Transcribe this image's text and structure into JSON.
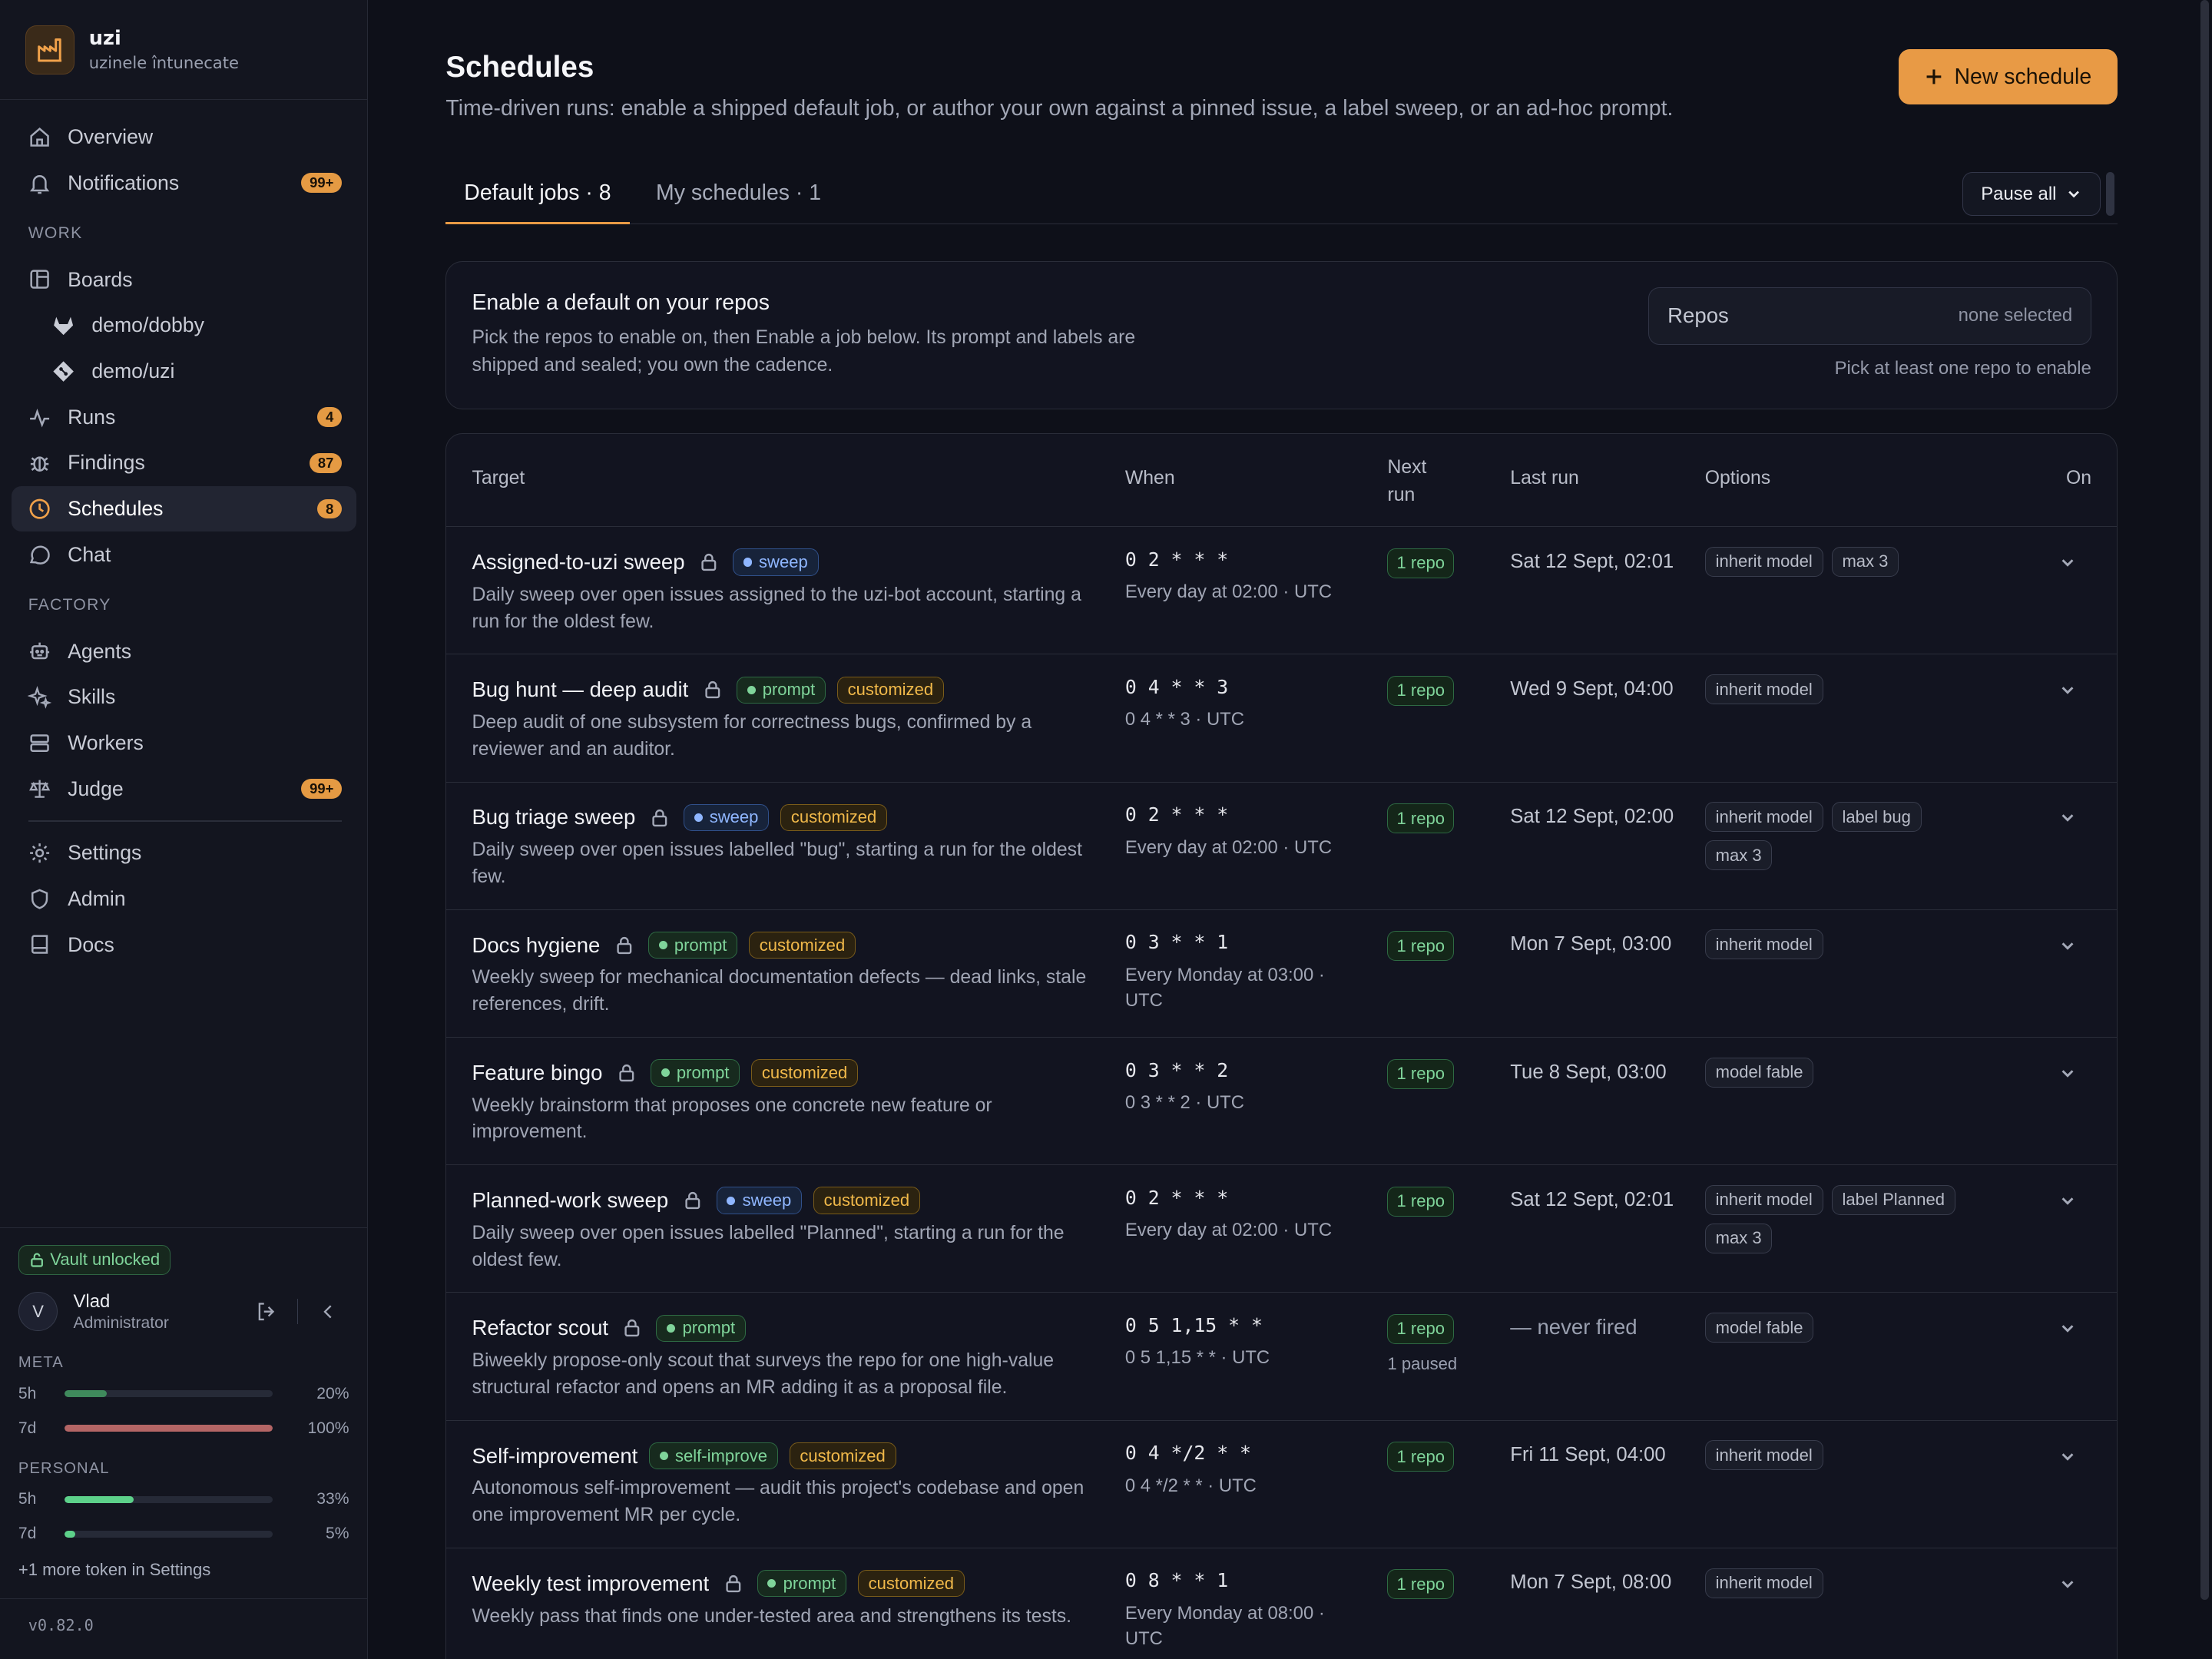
{
  "brand": {
    "name": "uzi",
    "subtitle": "uzinele întunecate"
  },
  "nav": {
    "overview": "Overview",
    "notifications": "Notifications",
    "notifications_badge": "99+",
    "work_section": "WORK",
    "boards": "Boards",
    "repo1": "demo/dobby",
    "repo2": "demo/uzi",
    "runs": "Runs",
    "runs_badge": "4",
    "findings": "Findings",
    "findings_badge": "87",
    "schedules": "Schedules",
    "schedules_badge": "8",
    "chat": "Chat",
    "factory_section": "FACTORY",
    "agents": "Agents",
    "skills": "Skills",
    "workers": "Workers",
    "judge": "Judge",
    "judge_badge": "99+",
    "settings": "Settings",
    "admin": "Admin",
    "docs": "Docs"
  },
  "sidebar_footer": {
    "vault": "Vault unlocked",
    "avatar_initial": "V",
    "user_name": "Vlad",
    "user_role": "Administrator",
    "meta_label": "META",
    "meta_5h_label": "5h",
    "meta_5h_value": "20%",
    "meta_5h_fraction": 0.2,
    "meta_7d_label": "7d",
    "meta_7d_value": "100%",
    "meta_7d_fraction": 1.0,
    "personal_label": "PERSONAL",
    "personal_5h_label": "5h",
    "personal_5h_value": "33%",
    "personal_5h_fraction": 0.33,
    "personal_7d_label": "7d",
    "personal_7d_value": "5%",
    "personal_7d_fraction": 0.05,
    "more_tokens": "+1 more token in Settings",
    "version": "v0.82.0"
  },
  "colors": {
    "accent": "#e89a45",
    "meta_5h": "#3f8a5c",
    "meta_7d": "#b46565",
    "personal": "#5dd18a"
  },
  "page": {
    "title": "Schedules",
    "subtitle": "Time-driven runs: enable a shipped default job, or author your own against a pinned issue, a label sweep, or an ad-hoc prompt.",
    "new_button": "New schedule",
    "tab_default": "Default jobs · 8",
    "tab_mine": "My schedules · 1",
    "pause_all": "Pause all"
  },
  "enable_panel": {
    "heading": "Enable a default on your repos",
    "text": "Pick the repos to enable on, then Enable a job below. Its prompt and labels are shipped and sealed; you own the cadence.",
    "repos_label": "Repos",
    "repos_value": "none selected",
    "hint": "Pick at least one repo to enable"
  },
  "table": {
    "headers": {
      "target": "Target",
      "when": "When",
      "next_run": "Next run",
      "last_run": "Last run",
      "options": "Options",
      "on": "On"
    },
    "rows": [
      {
        "name": "Assigned-to-uzi sweep",
        "kind": "sweep",
        "customized": "",
        "desc": "Daily sweep over open issues assigned to the uzi-bot account, starting a run for the oldest few.",
        "cron": "0 2 * * *",
        "human": "Every day at 02:00 · UTC",
        "next": "1 repo",
        "next_note": "",
        "last": "Sat 12 Sept, 02:01",
        "options": [
          "inherit model",
          "max 3"
        ]
      },
      {
        "name": "Bug hunt — deep audit",
        "kind": "prompt",
        "customized": "customized",
        "desc": "Deep audit of one subsystem for correctness bugs, confirmed by a reviewer and an auditor.",
        "cron": "0 4 * * 3",
        "human": "0 4 * * 3 · UTC",
        "next": "1 repo",
        "next_note": "",
        "last": "Wed 9 Sept, 04:00",
        "options": [
          "inherit model"
        ]
      },
      {
        "name": "Bug triage sweep",
        "kind": "sweep",
        "customized": "customized",
        "desc": "Daily sweep over open issues labelled \"bug\", starting a run for the oldest few.",
        "cron": "0 2 * * *",
        "human": "Every day at 02:00 · UTC",
        "next": "1 repo",
        "next_note": "",
        "last": "Sat 12 Sept, 02:00",
        "options": [
          "inherit model",
          "label bug",
          "max 3"
        ]
      },
      {
        "name": "Docs hygiene",
        "kind": "prompt",
        "customized": "customized",
        "desc": "Weekly sweep for mechanical documentation defects — dead links, stale references, drift.",
        "cron": "0 3 * * 1",
        "human": "Every Monday at 03:00 · UTC",
        "next": "1 repo",
        "next_note": "",
        "last": "Mon 7 Sept, 03:00",
        "options": [
          "inherit model"
        ]
      },
      {
        "name": "Feature bingo",
        "kind": "prompt",
        "customized": "customized",
        "desc": "Weekly brainstorm that proposes one concrete new feature or improvement.",
        "cron": "0 3 * * 2",
        "human": "0 3 * * 2 · UTC",
        "next": "1 repo",
        "next_note": "",
        "last": "Tue 8 Sept, 03:00",
        "options": [
          "model fable"
        ]
      },
      {
        "name": "Planned-work sweep",
        "kind": "sweep",
        "customized": "customized",
        "desc": "Daily sweep over open issues labelled \"Planned\", starting a run for the oldest few.",
        "cron": "0 2 * * *",
        "human": "Every day at 02:00 · UTC",
        "next": "1 repo",
        "next_note": "",
        "last": "Sat 12 Sept, 02:01",
        "options": [
          "inherit model",
          "label Planned",
          "max 3"
        ]
      },
      {
        "name": "Refactor scout",
        "kind": "prompt",
        "customized": "",
        "desc": "Biweekly propose-only scout that surveys the repo for one high-value structural refactor and opens an MR adding it as a proposal file.",
        "cron": "0 5 1,15 * *",
        "human": "0 5 1,15 * * · UTC",
        "next": "1 repo",
        "next_note": "1 paused",
        "last": "— never fired",
        "options": [
          "model fable"
        ]
      },
      {
        "name": "Self-improvement",
        "kind": "self-improve",
        "customized": "customized",
        "desc": "Autonomous self-improvement — audit this project's codebase and open one improvement MR per cycle.",
        "cron": "0 4 */2 * *",
        "human": "0 4 */2 * * · UTC",
        "next": "1 repo",
        "next_note": "",
        "last": "Fri 11 Sept, 04:00",
        "options": [
          "inherit model"
        ]
      },
      {
        "name": "Weekly test improvement",
        "kind": "prompt",
        "customized": "customized",
        "desc": "Weekly pass that finds one under-tested area and strengthens its tests.",
        "cron": "0 8 * * 1",
        "human": "Every Monday at 08:00 · UTC",
        "next": "1 repo",
        "next_note": "",
        "last": "Mon 7 Sept, 08:00",
        "options": [
          "inherit model"
        ]
      }
    ]
  }
}
